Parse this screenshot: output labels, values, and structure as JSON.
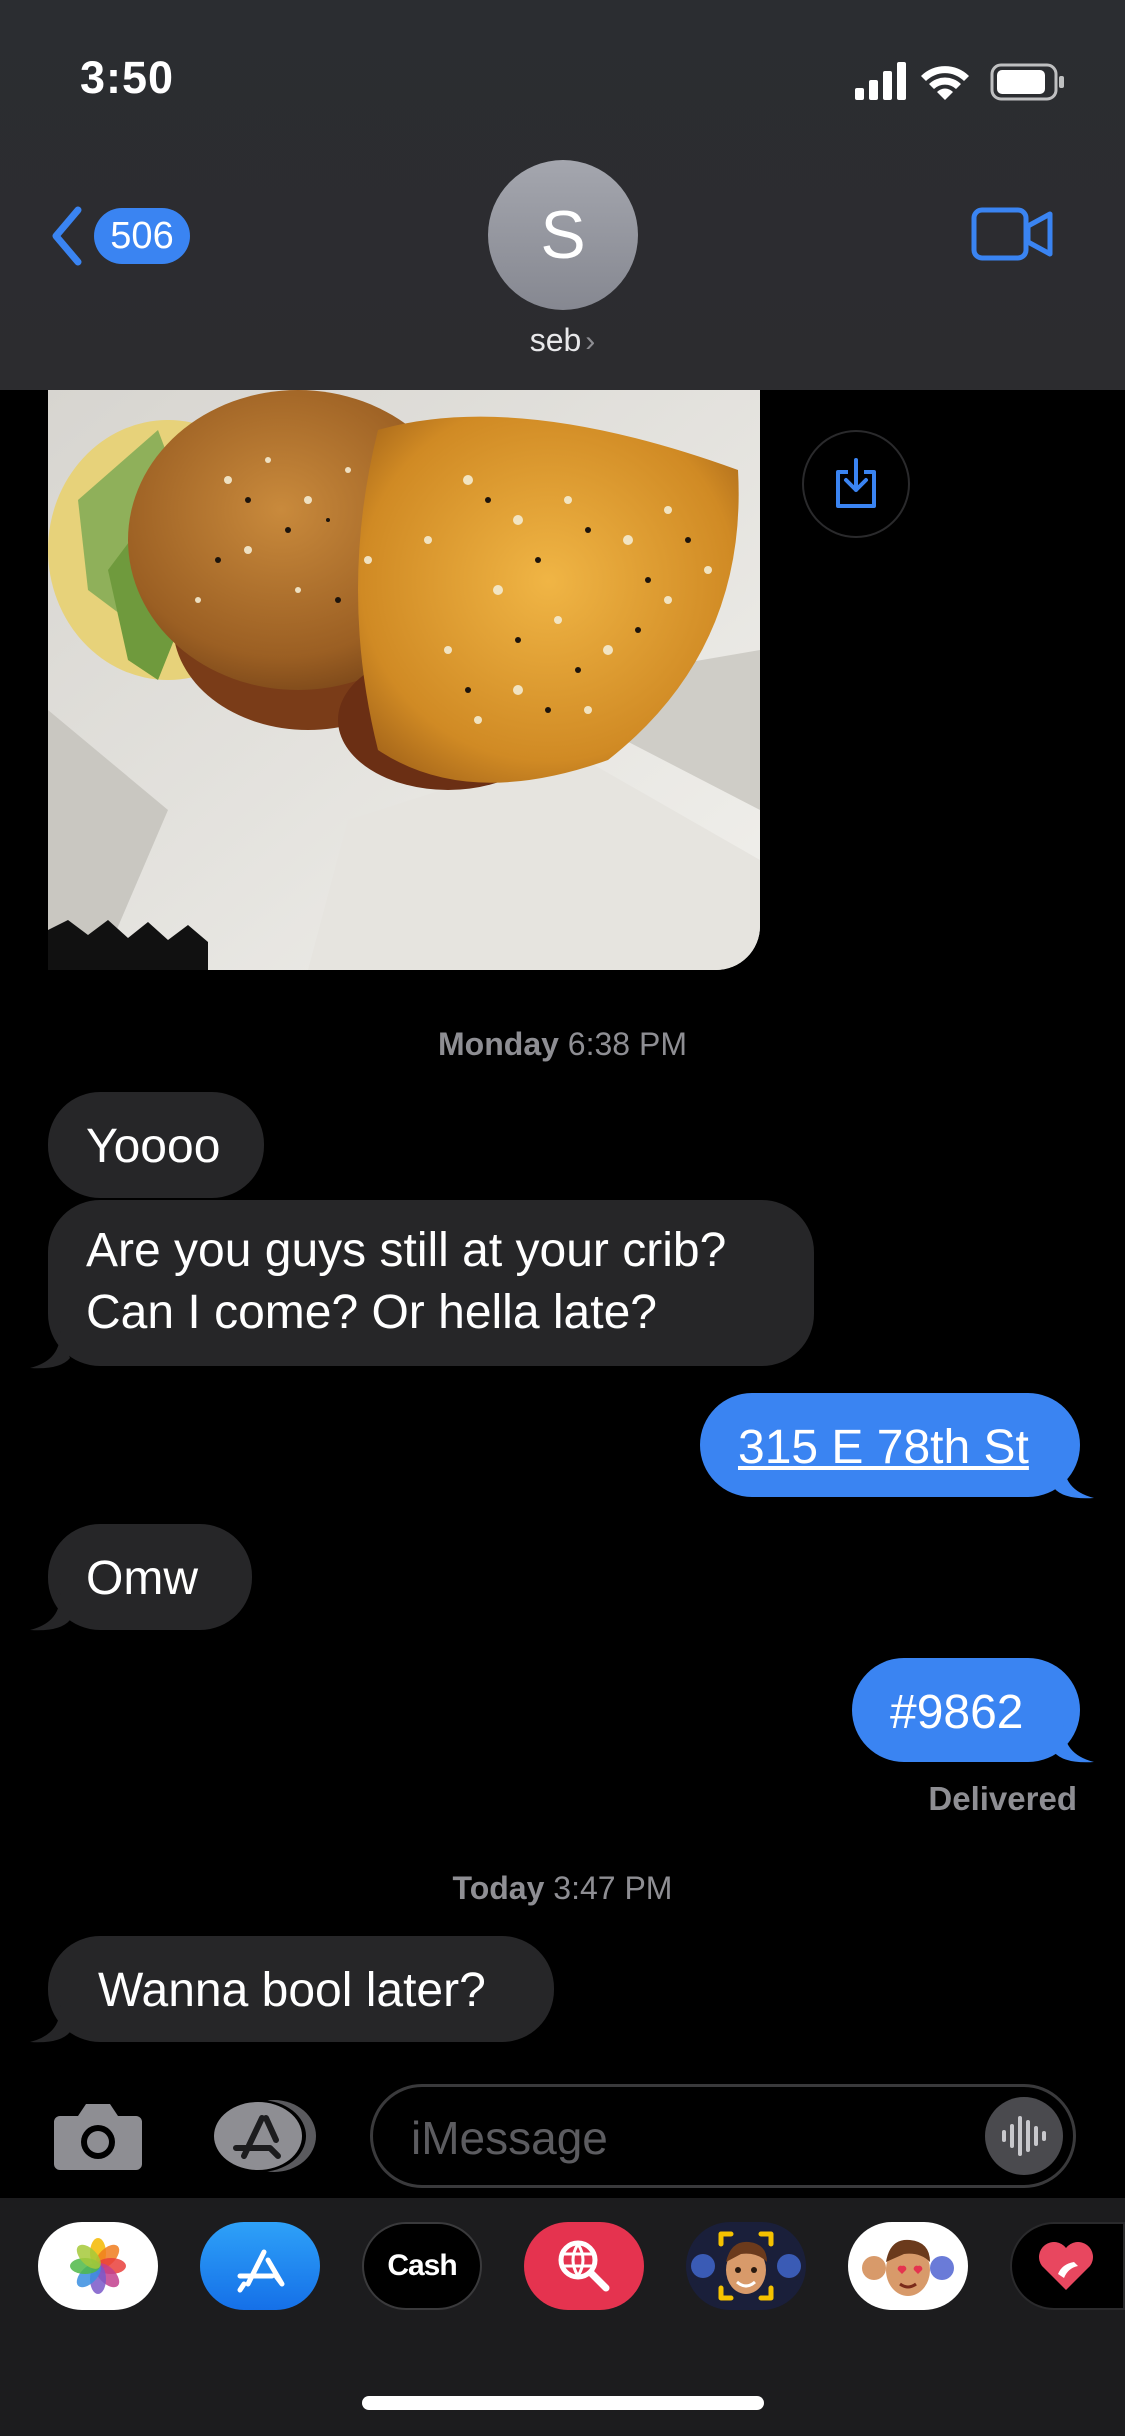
{
  "status_bar": {
    "time": "3:50"
  },
  "header": {
    "back_count": "506",
    "avatar_initial": "S",
    "contact_name": "seb",
    "name_chevron": "›"
  },
  "messages": {
    "timestamp_monday_day": "Monday",
    "timestamp_monday_time": "6:38 PM",
    "msg1": "Yoooo",
    "msg2_line1": "Are you guys still at your crib?",
    "msg2_line2": "Can I come? Or hella late?",
    "msg3": "315 E 78th St",
    "msg4": "Omw",
    "msg5": "#9862",
    "delivered": "Delivered",
    "timestamp_today_day": "Today",
    "timestamp_today_time": "3:47 PM",
    "msg6": "Wanna bool later?"
  },
  "input": {
    "placeholder": "iMessage"
  },
  "app_drawer": {
    "cash_label": "Cash",
    "cash_apple": ""
  },
  "colors": {
    "outgoing_bubble": "#3a84f2",
    "incoming_bubble": "#262628",
    "accent": "#3a84f2"
  },
  "icons": [
    "back-chevron-icon",
    "video-camera-icon",
    "save-download-icon",
    "camera-icon",
    "app-store-icon",
    "audio-waveform-icon",
    "photos-app-icon",
    "app-store-app-icon",
    "apple-cash-app-icon",
    "image-search-app-icon",
    "memoji-app-icon",
    "animoji-app-icon",
    "digital-touch-app-icon"
  ]
}
